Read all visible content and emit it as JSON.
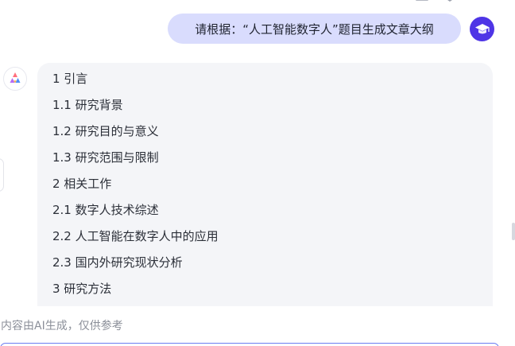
{
  "user_message": {
    "text": "请根据：“人工智能数字人”题目生成文章大纲"
  },
  "assistant_message": {
    "outline": [
      "1 引言",
      "1.1 研究背景",
      "1.2 研究目的与意义",
      "1.3 研究范围与限制",
      "2 相关工作",
      "2.1 数字人技术综述",
      "2.2 人工智能在数字人中的应用",
      "2.3 国内外研究现状分析",
      "3 研究方法"
    ]
  },
  "disclaimer": "内容由AI生成，仅供参考",
  "icons": {
    "user_avatar": "graduation-cap-icon",
    "assistant_avatar": "assistant-logo-icon"
  },
  "colors": {
    "user_bubble": "#d9dcfd",
    "user_avatar": "#4e35e6",
    "assistant_bubble": "#f4f5f8",
    "input_border": "#6b7cf2"
  }
}
